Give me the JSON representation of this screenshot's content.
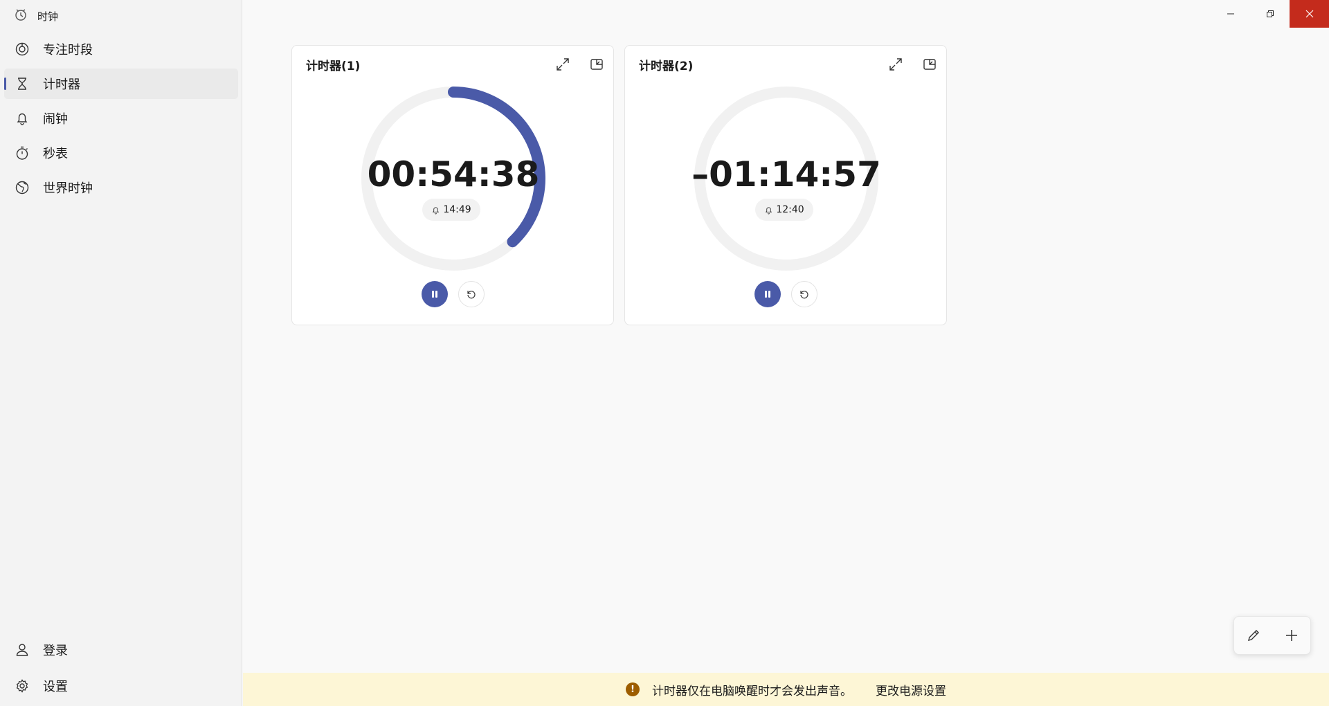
{
  "app": {
    "title": "时钟"
  },
  "sidebar": {
    "items": [
      {
        "label": "专注时段",
        "icon": "focus-icon"
      },
      {
        "label": "计时器",
        "icon": "hourglass-icon",
        "active": true
      },
      {
        "label": "闹钟",
        "icon": "bell-icon"
      },
      {
        "label": "秒表",
        "icon": "stopwatch-icon"
      },
      {
        "label": "世界时钟",
        "icon": "globe-icon"
      }
    ],
    "bottom": [
      {
        "label": "登录",
        "icon": "person-icon"
      },
      {
        "label": "设置",
        "icon": "gear-icon"
      }
    ]
  },
  "timers": [
    {
      "title": "计时器(1)",
      "time": "00:54:38",
      "alarm": "14:49",
      "progress": 0.38
    },
    {
      "title": "计时器(2)",
      "time": "–01:14:57",
      "alarm": "12:40",
      "progress": 0
    }
  ],
  "banner": {
    "message": "计时器仅在电脑唤醒时才会发出声音。",
    "link": "更改电源设置",
    "icon": "!"
  },
  "colors": {
    "accent": "#4a5aa8",
    "ring_track": "#f1f1f1",
    "close": "#c42b1c",
    "banner_bg": "#fdf6d6"
  }
}
